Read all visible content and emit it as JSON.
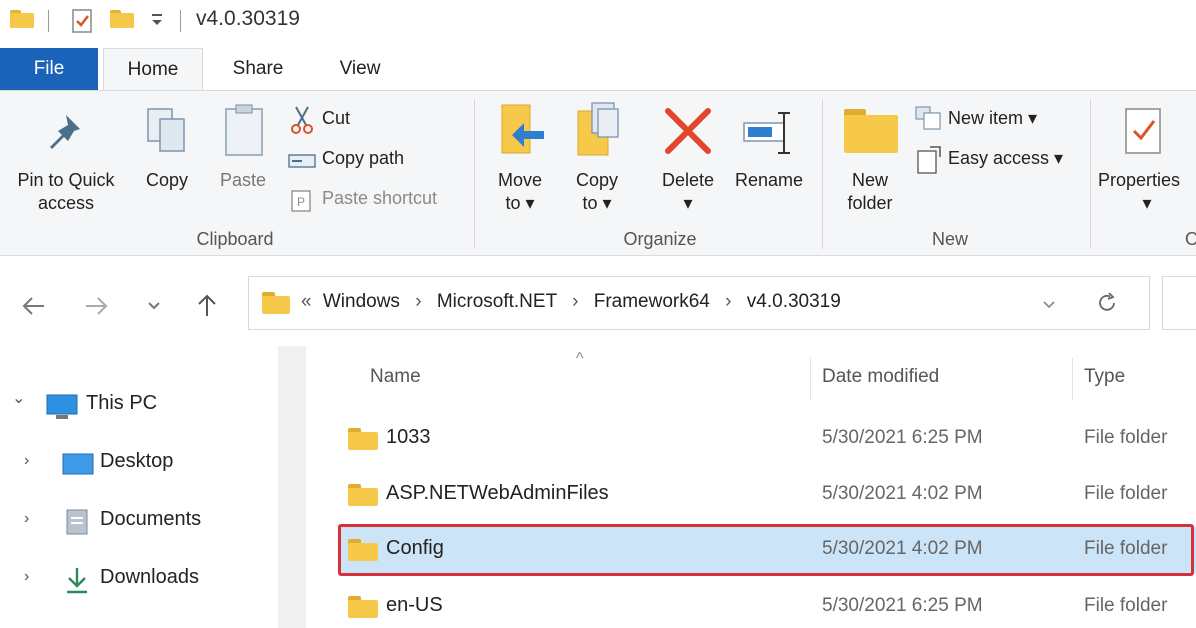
{
  "window": {
    "title": "v4.0.30319"
  },
  "tabs": [
    {
      "label": "File"
    },
    {
      "label": "Home"
    },
    {
      "label": "Share"
    },
    {
      "label": "View"
    }
  ],
  "ribbon": {
    "clipboard": {
      "pin_label_1": "Pin to Quick",
      "pin_label_2": "access",
      "copy_label": "Copy",
      "paste_label": "Paste",
      "cut_label": "Cut",
      "copy_path_label": "Copy path",
      "paste_shortcut_label": "Paste shortcut",
      "group_label": "Clipboard"
    },
    "organize": {
      "move_label_1": "Move",
      "move_label_2": "to ▾",
      "copy_to_label_1": "Copy",
      "copy_to_label_2": "to ▾",
      "delete_label": "Delete",
      "delete_arrow": "▾",
      "rename_label": "Rename",
      "group_label": "Organize"
    },
    "new": {
      "new_folder_label_1": "New",
      "new_folder_label_2": "folder",
      "new_item_label": "New item ▾",
      "easy_access_label": "Easy access ▾",
      "group_label": "New"
    },
    "open": {
      "properties_label": "Properties",
      "properties_arrow": "▾",
      "group_label_partial": "O"
    }
  },
  "address": {
    "overflow": "«",
    "crumbs": [
      "Windows",
      "Microsoft.NET",
      "Framework64",
      "v4.0.30319"
    ],
    "separator": "›"
  },
  "nav_pane": [
    {
      "label": "This PC",
      "expander": "⌄",
      "icon": "monitor-icon"
    },
    {
      "label": "Desktop",
      "expander": "›",
      "icon": "desktop-icon"
    },
    {
      "label": "Documents",
      "expander": "›",
      "icon": "documents-icon"
    },
    {
      "label": "Downloads",
      "expander": "›",
      "icon": "download-icon"
    }
  ],
  "file_list": {
    "columns": {
      "name": "Name",
      "date": "Date modified",
      "type": "Type"
    },
    "sort_indicator": "^",
    "rows": [
      {
        "name": "1033",
        "date": "5/30/2021 6:25 PM",
        "type": "File folder"
      },
      {
        "name": "ASP.NETWebAdminFiles",
        "date": "5/30/2021 4:02 PM",
        "type": "File folder"
      },
      {
        "name": "Config",
        "date": "5/30/2021 4:02 PM",
        "type": "File folder",
        "selected": true
      },
      {
        "name": "en-US",
        "date": "5/30/2021 6:25 PM",
        "type": "File folder"
      }
    ]
  },
  "colors": {
    "file_tab": "#1a63b8",
    "selection": "#cce4f7",
    "highlight_border": "#d6303a",
    "folder": "#f7c94a"
  }
}
